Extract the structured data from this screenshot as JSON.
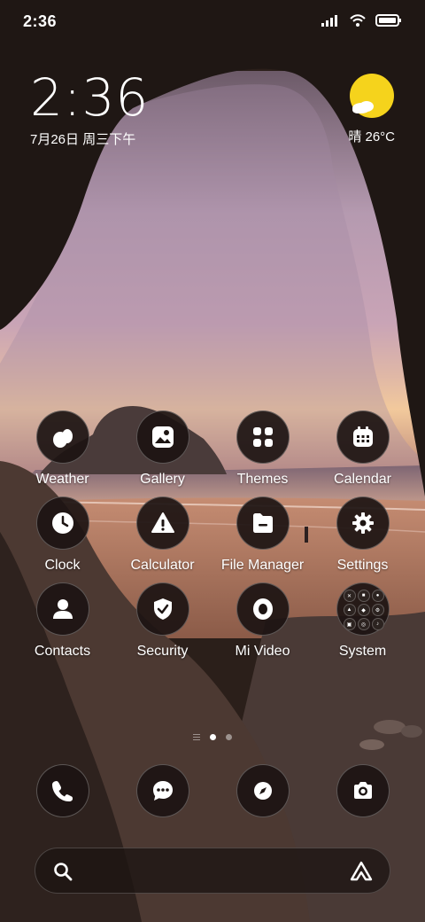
{
  "status_bar": {
    "time": "2:36",
    "icons": [
      "signal-icon",
      "wifi-icon",
      "battery-icon"
    ]
  },
  "clock_widget": {
    "time": "2:36",
    "date": "7月26日 周三下午"
  },
  "weather_widget": {
    "icon": "sun-cloud-icon",
    "text": "晴 26°C"
  },
  "apps": [
    {
      "label": "Weather",
      "icon": "weather-drop-icon"
    },
    {
      "label": "Gallery",
      "icon": "gallery-icon"
    },
    {
      "label": "Themes",
      "icon": "themes-grid-icon"
    },
    {
      "label": "Calendar",
      "icon": "calendar-icon"
    },
    {
      "label": "Clock",
      "icon": "clock-icon"
    },
    {
      "label": "Calculator",
      "icon": "calculator-icon"
    },
    {
      "label": "File Manager",
      "icon": "file-manager-icon"
    },
    {
      "label": "Settings",
      "icon": "settings-gear-icon"
    },
    {
      "label": "Contacts",
      "icon": "contacts-icon"
    },
    {
      "label": "Security",
      "icon": "security-shield-icon"
    },
    {
      "label": "Mi Video",
      "icon": "mi-video-icon"
    },
    {
      "label": "System",
      "icon": "system-folder-icon"
    }
  ],
  "dock": [
    "phone-icon",
    "messages-icon",
    "browser-compass-icon",
    "camera-icon"
  ],
  "search_bar": {
    "left_icon": "search-icon",
    "right_icon": "assistant-icon"
  },
  "page_indicator": {
    "pages": 2,
    "active_page": 1
  },
  "colors": {
    "icon_bg": "#1c1412",
    "sun": "#f5d31c",
    "text": "#ffffff"
  }
}
